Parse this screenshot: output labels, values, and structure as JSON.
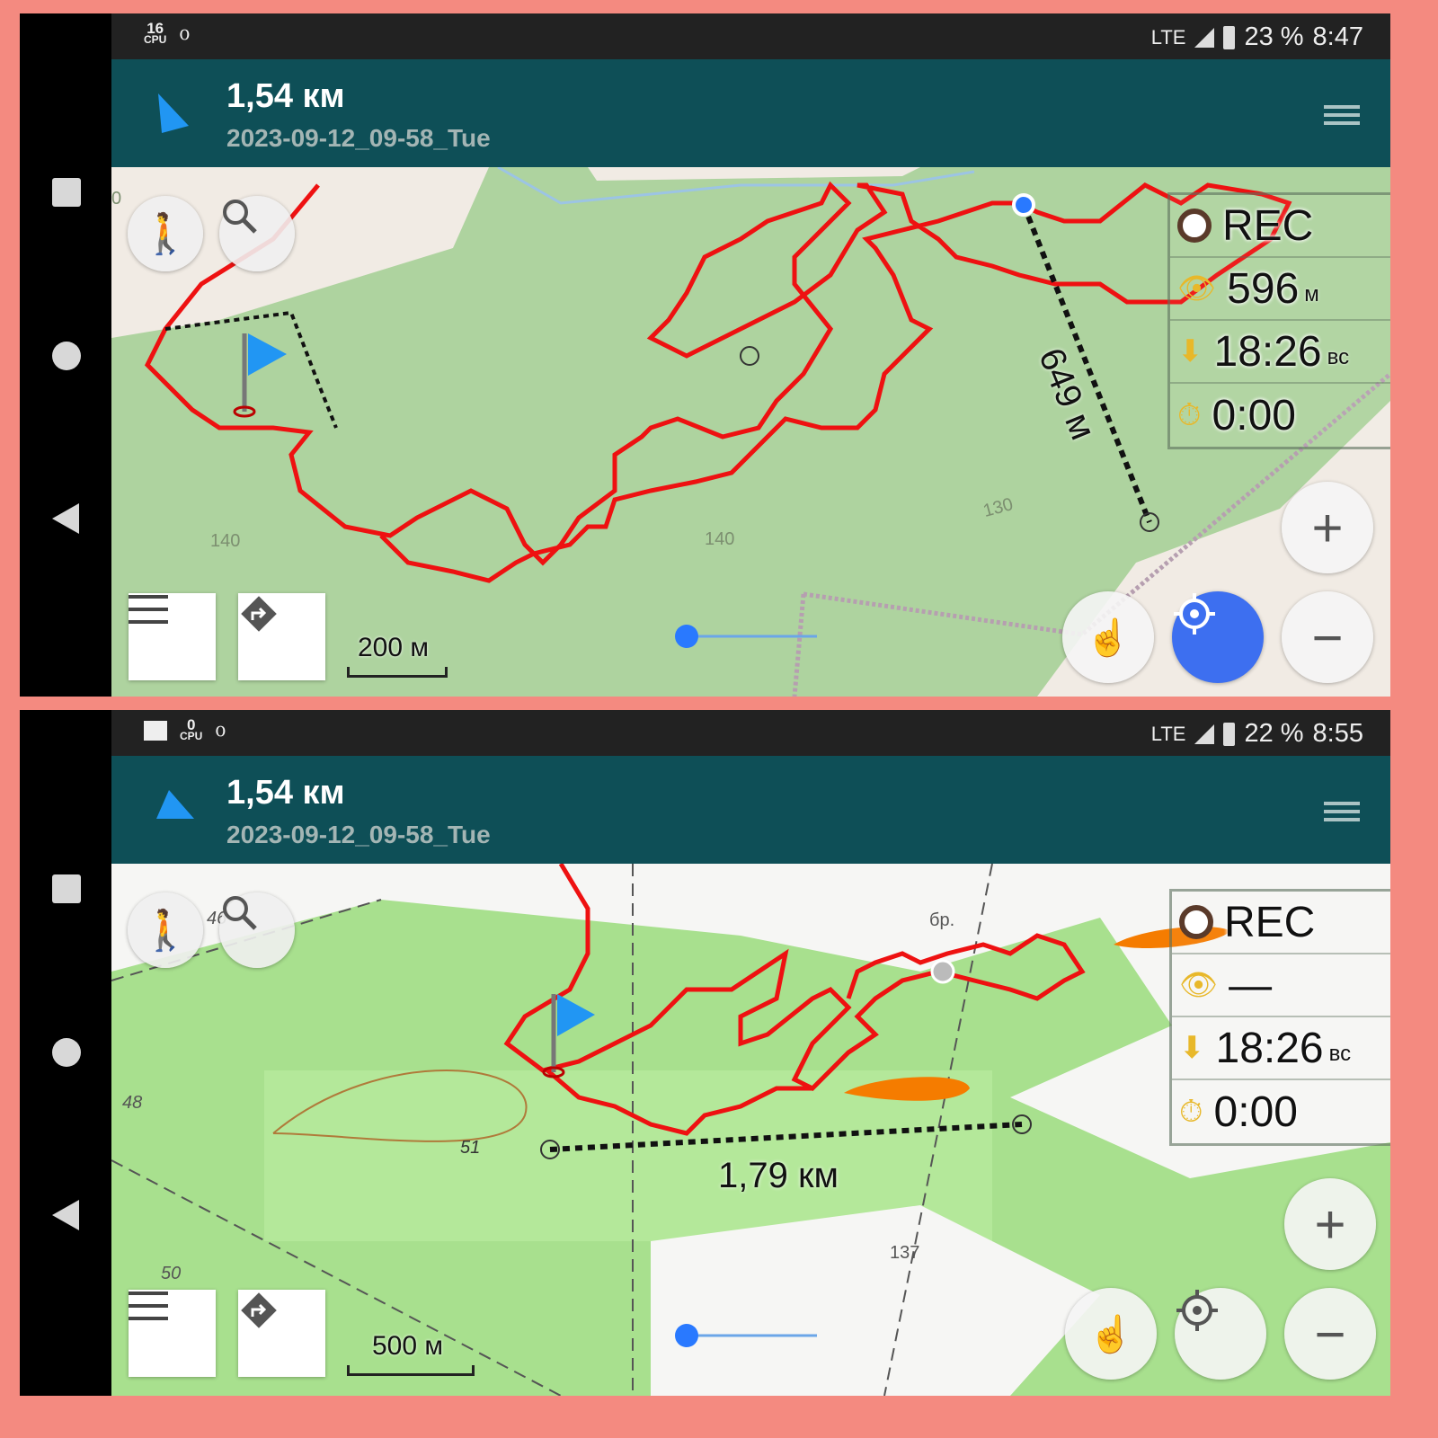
{
  "screenshots": [
    {
      "status": {
        "cpu": "16",
        "cpu_label": "CPU",
        "network": "LTE",
        "battery": "23 %",
        "time": "8:47"
      },
      "header": {
        "distance": "1,54 км",
        "track_name": "2023-09-12_09-58_Tue"
      },
      "widgets": {
        "rec": "REC",
        "distance_value": "596",
        "distance_unit": "м",
        "time_value": "18:26",
        "time_unit": "вс",
        "timer": "0:00"
      },
      "map": {
        "measure_label": "649 м",
        "scale": "200 м",
        "contours": [
          "140",
          "140",
          "130",
          "0"
        ]
      }
    },
    {
      "status": {
        "cpu": "0",
        "cpu_label": "CPU",
        "network": "LTE",
        "battery": "22 %",
        "time": "8:55"
      },
      "header": {
        "distance": "1,54 км",
        "track_name": "2023-09-12_09-58_Tue"
      },
      "widgets": {
        "rec": "REC",
        "distance_value": "—",
        "time_value": "18:26",
        "time_unit": "вс",
        "timer": "0:00"
      },
      "map": {
        "measure_label": "1,79 км",
        "scale": "500 м",
        "contours": [
          "46",
          "48",
          "51",
          "50",
          "137",
          "бр."
        ]
      }
    }
  ],
  "colors": {
    "track": "#ee1111",
    "header": "#0e4f57",
    "accent": "#3d6ff0",
    "map_green": "#aed39f"
  }
}
